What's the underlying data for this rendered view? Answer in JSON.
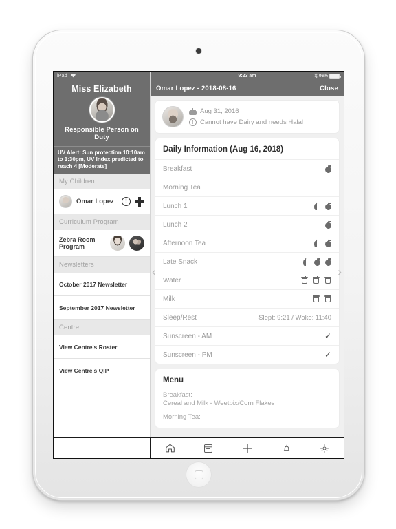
{
  "device": {
    "name": "ipad-tablet"
  },
  "sidebar": {
    "status_bar": {
      "carrier": "iPad",
      "wifi_icon": "wifi-icon"
    },
    "staff_name": "Miss Elizabeth",
    "staff_avatar": "staff-avatar",
    "staff_role": "Responsible Person on Duty",
    "uv_alert": "UV Alert: Sun protection 10:10am to 1:30pm, UV Index predicted to reach 4 [Moderate]",
    "sections": [
      {
        "heading": "My Children",
        "rows": [
          {
            "label": "Omar Lopez",
            "avatar": "child-avatar",
            "icons": [
              "alert-icon",
              "plus-icon"
            ]
          }
        ]
      },
      {
        "heading": "Curriculum Program",
        "rows": [
          {
            "label": "Zebra Room Program",
            "avatars": [
              "educator-avatar-1",
              "educator-avatar-2"
            ]
          }
        ]
      },
      {
        "heading": "Newsletters",
        "rows": [
          {
            "label": "October 2017 Newsletter"
          },
          {
            "label": "September 2017 Newsletter"
          }
        ]
      },
      {
        "heading": "Centre",
        "rows": [
          {
            "label": "View Centre's Roster"
          },
          {
            "label": "View Centre's QIP"
          }
        ]
      }
    ]
  },
  "main": {
    "status_bar": {
      "time": "9:23 am",
      "bluetooth_icon": "bluetooth-icon",
      "battery": "96%"
    },
    "nav": {
      "title": "Omar Lopez - 2018-08-16",
      "close_label": "Close"
    },
    "profile": {
      "avatar": "child-photo",
      "birthday_icon": "cake-icon",
      "birthday": "Aug 31, 2016",
      "warning_icon": "alert-icon",
      "dietary": "Cannot have Dairy and needs Halal"
    },
    "daily": {
      "title": "Daily Information (Aug 16, 2018)",
      "rows": [
        {
          "label": "Breakfast",
          "icons": [
            "apple"
          ]
        },
        {
          "label": "Morning Tea",
          "icons": []
        },
        {
          "label": "Lunch 1",
          "icons": [
            "half-apple",
            "apple"
          ]
        },
        {
          "label": "Lunch 2",
          "icons": [
            "apple"
          ]
        },
        {
          "label": "Afternoon Tea",
          "icons": [
            "half-apple",
            "apple"
          ]
        },
        {
          "label": "Late Snack",
          "icons": [
            "half-apple",
            "apple",
            "apple"
          ]
        },
        {
          "label": "Water",
          "icons": [
            "cup",
            "cup",
            "cup"
          ]
        },
        {
          "label": "Milk",
          "icons": [
            "cup",
            "cup"
          ]
        },
        {
          "label": "Sleep/Rest",
          "icons": [],
          "text": "Slept: 9:21 / Woke: 11:40"
        },
        {
          "label": "Sunscreen - AM",
          "icons": [
            "check"
          ]
        },
        {
          "label": "Sunscreen - PM",
          "icons": [
            "check"
          ]
        }
      ]
    },
    "menu": {
      "title": "Menu",
      "lines": [
        "Breakfast:",
        "Cereal and Milk - Weetbix/Corn Flakes",
        "Morning Tea:"
      ]
    },
    "pager": {
      "prev_icon": "chevron-left-icon",
      "next_icon": "chevron-right-icon"
    }
  },
  "tabbar": {
    "items": [
      {
        "name": "home-icon",
        "label": ""
      },
      {
        "name": "calendar-icon",
        "label": ""
      },
      {
        "name": "plus-icon",
        "label": ""
      },
      {
        "name": "bell-icon",
        "label": ""
      },
      {
        "name": "gear-icon",
        "label": ""
      }
    ]
  }
}
